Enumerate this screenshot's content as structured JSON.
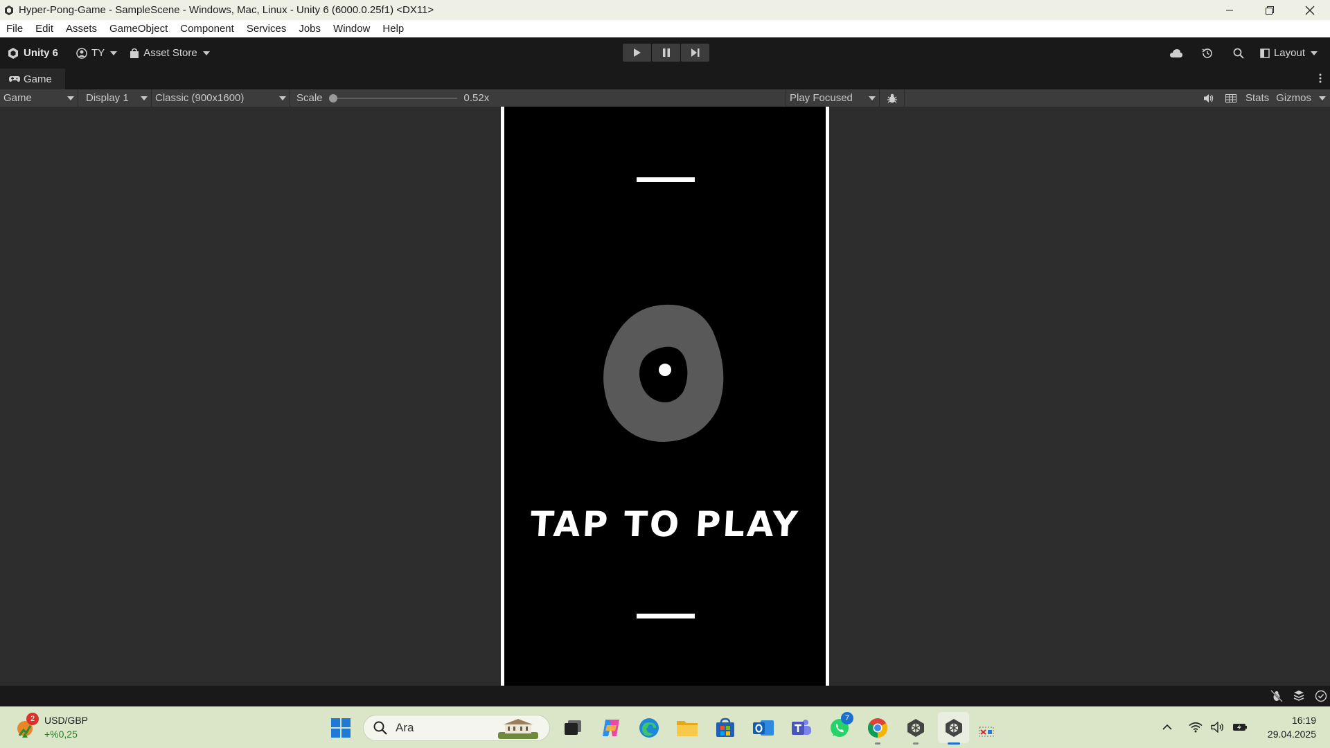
{
  "window": {
    "title": "Hyper-Pong-Game - SampleScene - Windows, Mac, Linux - Unity 6 (6000.0.25f1) <DX11>"
  },
  "menu": {
    "items": [
      "File",
      "Edit",
      "Assets",
      "GameObject",
      "Component",
      "Services",
      "Jobs",
      "Window",
      "Help"
    ]
  },
  "toolbar": {
    "unity_label": "Unity 6",
    "account_label": "TY",
    "asset_store_label": "Asset Store",
    "layout_label": "Layout"
  },
  "tab": {
    "label": "Game"
  },
  "game_view": {
    "view_mode": "Game",
    "display": "Display 1",
    "resolution": "Classic (900x1600)",
    "scale_label": "Scale",
    "scale_value": "0.52x",
    "scale_fraction": 0.0,
    "play_mode": "Play Focused",
    "stats_label": "Stats",
    "gizmos_label": "Gizmos"
  },
  "game": {
    "tap_text": "TAP TO PLAY"
  },
  "taskbar": {
    "widget_badge": "2",
    "widget_title": "USD/GBP",
    "widget_value": "+%0,25",
    "search_placeholder": "Ara",
    "whatsapp_badge": "7",
    "time": "16:19",
    "date": "29.04.2025"
  },
  "colors": {
    "editor_bg": "#191919",
    "game_area_bg": "#2d2d2d",
    "toolbar_bg": "#3c3c3c",
    "taskbar_bg": "#dbe6c8",
    "blob": "#595959"
  },
  "icons": {
    "unity": "unity-logo-icon",
    "account": "account-icon",
    "asset_store": "shopping-bag-icon",
    "play": "play-icon",
    "pause": "pause-icon",
    "step": "step-icon",
    "cloud": "cloud-icon",
    "history": "history-icon",
    "search": "search-icon",
    "layout": "layout-icon"
  }
}
